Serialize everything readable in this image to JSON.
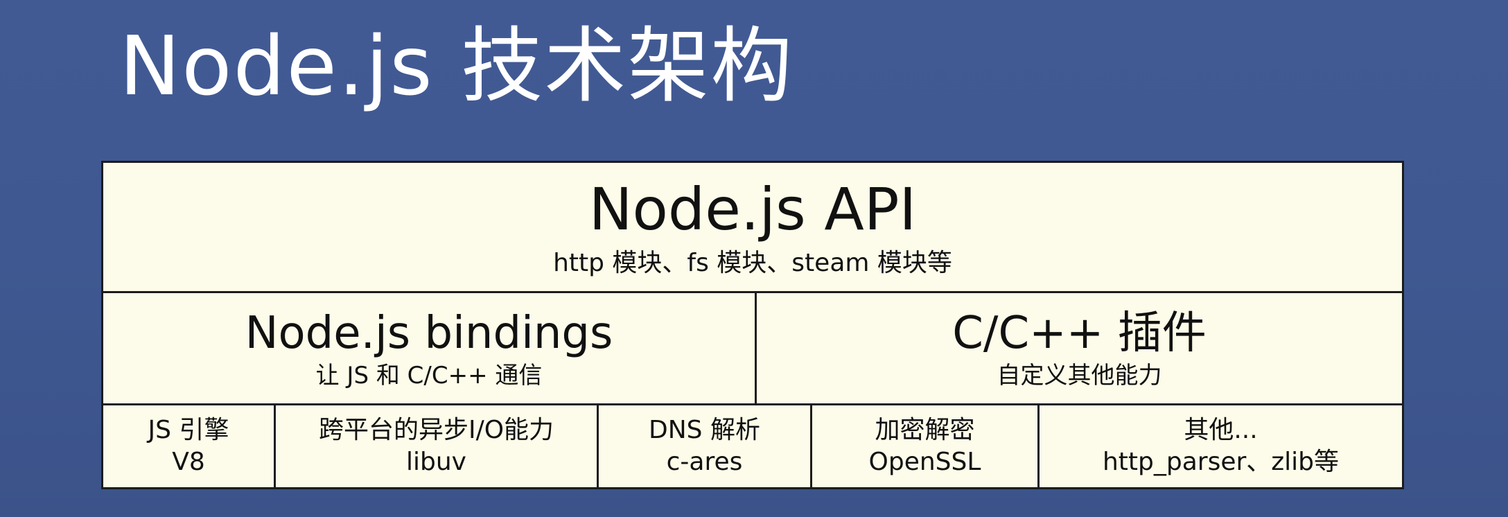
{
  "title": "Node.js 技术架构",
  "api": {
    "title": "Node.js API",
    "subtitle": "http 模块、fs 模块、steam 模块等"
  },
  "bindings": {
    "title": "Node.js bindings",
    "subtitle": "让 JS 和 C/C++ 通信"
  },
  "addons": {
    "title": "C/C++ 插件",
    "subtitle": "自定义其他能力"
  },
  "deps": [
    {
      "line1": "JS 引擎",
      "line2": "V8"
    },
    {
      "line1": "跨平台的异步I/O能力",
      "line2": "libuv"
    },
    {
      "line1": "DNS 解析",
      "line2": "c-ares"
    },
    {
      "line1": "加密解密",
      "line2": "OpenSSL"
    },
    {
      "line1": "其他...",
      "line2": "http_parser、zlib等"
    }
  ]
}
